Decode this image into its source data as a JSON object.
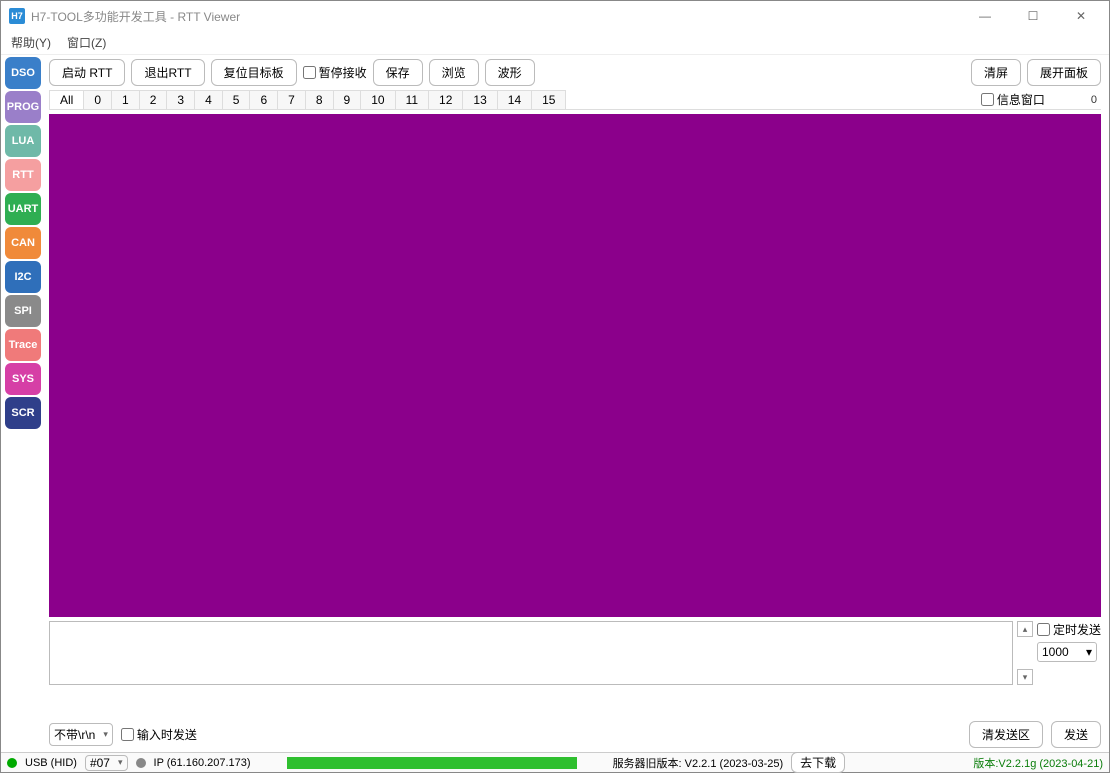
{
  "title": {
    "icon": "H7",
    "text": "H7-TOOL多功能开发工具 - RTT Viewer"
  },
  "menu": {
    "help": "帮助(Y)",
    "window": "窗口(Z)"
  },
  "sidebar": [
    {
      "label": "DSO",
      "bg": "#3a7fc9"
    },
    {
      "label": "PROG",
      "bg": "#9a7fc9"
    },
    {
      "label": "LUA",
      "bg": "#6fb9a8"
    },
    {
      "label": "RTT",
      "bg": "#f59fa0"
    },
    {
      "label": "UART",
      "bg": "#2fae52"
    },
    {
      "label": "CAN",
      "bg": "#f08a3a"
    },
    {
      "label": "I2C",
      "bg": "#2f6fba"
    },
    {
      "label": "SPI",
      "bg": "#8a8a8a"
    },
    {
      "label": "Trace",
      "bg": "#f07a7a"
    },
    {
      "label": "SYS",
      "bg": "#d63fa6"
    },
    {
      "label": "SCR",
      "bg": "#2f3f8a"
    }
  ],
  "toolbar": {
    "start": "启动 RTT",
    "exit": "退出RTT",
    "reset": "复位目标板",
    "pause_label": "暂停接收",
    "save": "保存",
    "browse": "浏览",
    "wave": "波形",
    "clear": "清屏",
    "expand": "展开面板"
  },
  "tabs": {
    "all": "All",
    "nums": [
      "0",
      "1",
      "2",
      "3",
      "4",
      "5",
      "6",
      "7",
      "8",
      "9",
      "10",
      "11",
      "12",
      "13",
      "14",
      "15"
    ],
    "infowin_label": "信息窗口",
    "count": "0"
  },
  "send": {
    "timed_label": "定时发送",
    "interval": "1000",
    "line_ending": "不带\\r\\n",
    "oninput_label": "输入时发送",
    "clear_area": "清发送区",
    "send_btn": "发送"
  },
  "status": {
    "usb": "USB (HID)",
    "unit_sel": "#07",
    "ip": "IP (61.160.207.173)",
    "server": "服务器旧版本: V2.2.1 (2023-03-25)",
    "download": "去下载",
    "version": "版本:V2.2.1g (2023-04-21)"
  }
}
